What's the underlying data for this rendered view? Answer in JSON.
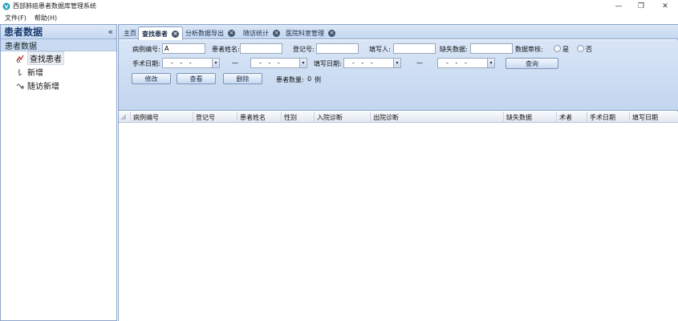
{
  "window": {
    "title": "西部肺癌患者数据库管理系统",
    "controls": {
      "minimize": "—",
      "restore": "❐",
      "close": "✕"
    }
  },
  "menu": [
    {
      "label": "文件(F)"
    },
    {
      "label": "帮助(H)"
    }
  ],
  "left_panel": {
    "title": "患者数据",
    "collapse_glyph": "«",
    "group": "患者数据",
    "items": [
      {
        "label": "查找患者",
        "icon": "search-patient-icon",
        "selected": true
      },
      {
        "label": "新增",
        "icon": "add-icon",
        "selected": false
      },
      {
        "label": "随访新增",
        "icon": "followup-icon",
        "selected": false
      }
    ]
  },
  "tabs": [
    {
      "label": "主页",
      "closable": false,
      "active": false
    },
    {
      "label": "查找患者",
      "closable": true,
      "active": true
    },
    {
      "label": "分析数据导出",
      "closable": true,
      "active": false
    },
    {
      "label": "随访统计",
      "closable": true,
      "active": false
    },
    {
      "label": "医院科室管理",
      "closable": true,
      "active": false
    }
  ],
  "filters": {
    "case_no_label": "病例编号:",
    "case_no_value": "A",
    "patient_name_label": "患者姓名:",
    "patient_name_value": "",
    "register_no_label": "登记号:",
    "register_no_value": "",
    "filler_label": "填写人:",
    "filler_value": "",
    "missing_label": "缺失数据:",
    "missing_value": "",
    "review_label": "数据审核:",
    "review_yes": "是",
    "review_no": "否",
    "surgery_date_label": "手术日期:",
    "fill_date_label": "填写日期:",
    "date_placeholder": "- - -",
    "range_dash": "—",
    "dropdown_glyph": "▾",
    "query_button": "查询",
    "edit_button": "修改",
    "view_button": "查看",
    "delete_button": "删除",
    "patient_count_label": "患者数量:",
    "patient_count_value": "0",
    "patient_count_unit": "例"
  },
  "grid": {
    "columns": [
      "病例编号",
      "登记号",
      "患者姓名",
      "性别",
      "入院诊断",
      "出院诊断",
      "缺失数据",
      "术者",
      "手术日期",
      "填写日期"
    ],
    "rows": []
  }
}
